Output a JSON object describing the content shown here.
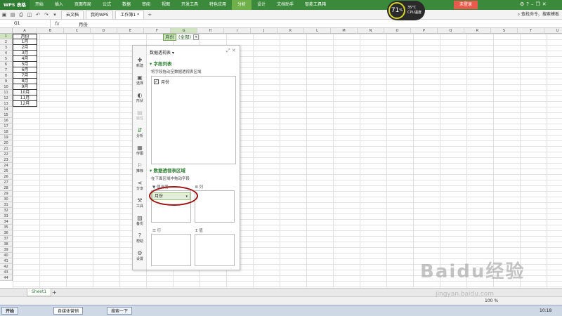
{
  "ribbon": {
    "app_name": "WPS 表格",
    "tabs": [
      "开始",
      "插入",
      "页面布局",
      "公式",
      "数据",
      "审阅",
      "视图",
      "开发工具",
      "特色应用",
      "分析",
      "设计",
      "文档助手",
      "智能工具箱"
    ],
    "active_tab": "分析",
    "login": "未登录"
  },
  "monitor": {
    "percent": "71",
    "unit": "%",
    "temp": "35°C",
    "label": "CPU温度"
  },
  "doc_tabs": [
    "云文档",
    "我的WPS",
    "工作簿1 *"
  ],
  "active_doc": "工作簿1 *",
  "search_cmd": "查找命令、搜索模板",
  "formula_bar": {
    "cell": "G1",
    "fx": "fx",
    "value": "月份"
  },
  "sheet": {
    "columns": [
      "A",
      "B",
      "C",
      "D",
      "E",
      "F",
      "G",
      "H",
      "I",
      "J",
      "K",
      "L",
      "M",
      "N",
      "O",
      "P",
      "Q",
      "R",
      "S",
      "T",
      "U",
      "V"
    ],
    "selected_column": "G",
    "selected_row": 1,
    "row_count": 44,
    "cells_A": [
      "月份",
      "1月",
      "2月",
      "3月",
      "4月",
      "5月",
      "6月",
      "7月",
      "8月",
      "9月",
      "10月",
      "11月",
      "12月"
    ],
    "pivot_filter": {
      "label": "月份",
      "value": "(全部)"
    }
  },
  "pivot_panel": {
    "title": "数据透视表",
    "sidebar": [
      "新建",
      "选择",
      "形状",
      "属性",
      "分析",
      "传图",
      "推荐",
      "分享",
      "工具",
      "备份",
      "帮助",
      "设置"
    ],
    "field_list_header": "字段列表",
    "field_list_hint": "将字段拖动至数据透视表区域",
    "fields": [
      {
        "name": "月份",
        "checked": true
      }
    ],
    "areas_header": "数据透视表区域",
    "areas_hint": "在下面区域中拖动字段",
    "filter_label": "筛选器",
    "column_label": "列",
    "row_label": "行",
    "value_label": "值",
    "filter_chip": "月份"
  },
  "sheet_tabs": [
    "Sheet1"
  ],
  "status": {
    "zoom": "100 %"
  },
  "taskbar": {
    "start": "开始",
    "items": [
      "自媒体营销",
      "搜索一下"
    ],
    "clock": "10:18"
  },
  "watermark": {
    "main": "Baidu经验",
    "sub": "jingyan.baidu.com"
  }
}
